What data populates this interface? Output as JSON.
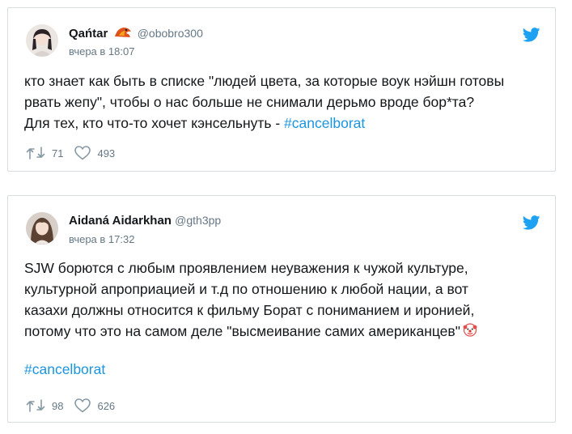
{
  "tweets": [
    {
      "name": "Qańtar",
      "handle": "@obobro300",
      "time": "вчера в 18:07",
      "lines": [
        "кто знает как быть в списке \"людей цвета, за которые воук нэйшн готовы",
        "рвать жепу\", чтобы о нас больше не снимали дерьмо вроде бор*та?",
        "Для тех, кто что-то хочет кэнсельнуть - "
      ],
      "hashtag": "#cancelborat",
      "retweets": "71",
      "likes": "493"
    },
    {
      "name": "Aidaná Aidarkhan",
      "handle": "@gth3pp",
      "time": "вчера в 17:32",
      "lines": [
        "SJW борются с любым проявлением неуважения к чужой культуре,",
        "культурной апроприацией и т.д по отношению к любой нации, а вот",
        "казахи должны относится к фильму Борат с пониманием и иронией,",
        "потому что это на самом деле \"высмеивание самих американцев\""
      ],
      "hashtag": "#cancelborat",
      "retweets": "98",
      "likes": "626"
    }
  ],
  "colors": {
    "link": "#1b95e0",
    "meta": "#657786",
    "border": "#d8dde3"
  }
}
